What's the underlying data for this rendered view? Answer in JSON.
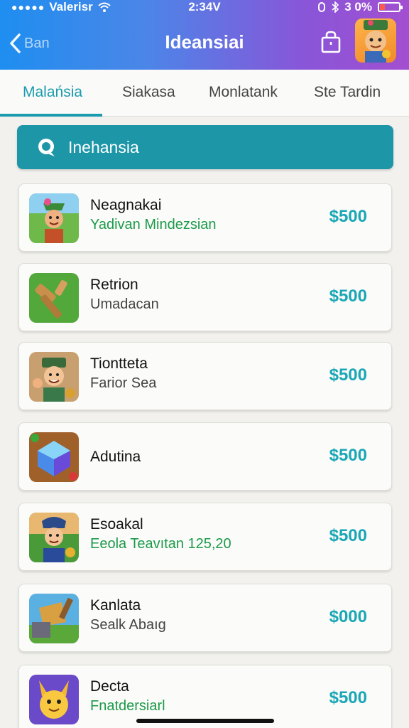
{
  "status": {
    "carrier": "Valerisr",
    "time": "2:34V",
    "battery": "3 0%",
    "battery_level": 0.3
  },
  "header": {
    "back_label": "Ban",
    "title": "Ideansiai"
  },
  "tabs": [
    {
      "label": "Malańsia",
      "active": true
    },
    {
      "label": "Siakasa",
      "active": false
    },
    {
      "label": "Monlatank",
      "active": false
    },
    {
      "label": "Ste Tardin",
      "active": false
    }
  ],
  "banner": {
    "label": "Inehansia"
  },
  "items": [
    {
      "name": "Neagnakai",
      "subtitle": "Yadivan Mindezsian",
      "price": "$500",
      "icon": "hero-warrior-icon"
    },
    {
      "name": "Retrion",
      "subtitle": "Umadacan",
      "price": "$500",
      "icon": "wooden-hammer-icon"
    },
    {
      "name": "Tiontteta",
      "subtitle": "Farior Sea",
      "price": "$500",
      "icon": "adventurer-icon"
    },
    {
      "name": "Adutina",
      "subtitle": "",
      "price": "$500",
      "icon": "crystal-cube-icon"
    },
    {
      "name": "Esoakal",
      "subtitle": "Eeola Teavıtan 125,20",
      "price": "$500",
      "icon": "soldier-icon"
    },
    {
      "name": "Kanlata",
      "subtitle": "Sealk Abaıg",
      "price": "$000",
      "icon": "treasure-cart-icon"
    },
    {
      "name": "Decta",
      "subtitle": "Fnatdersiarl",
      "price": "$500",
      "icon": "yellow-creature-icon"
    }
  ],
  "colors": {
    "accent": "#1a9cae",
    "green_subtitle": "#1c9a4a",
    "header_start": "#1e8ef0",
    "header_end": "#a24fd0"
  }
}
